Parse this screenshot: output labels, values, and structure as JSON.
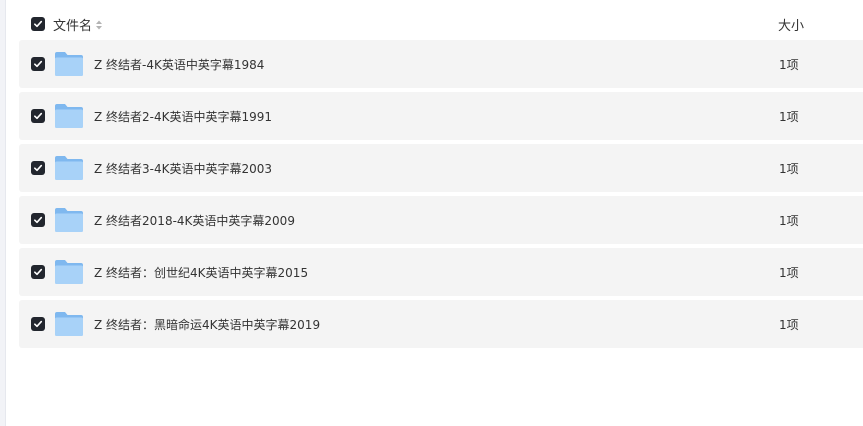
{
  "header": {
    "name_label": "文件名",
    "size_label": "大小",
    "select_all_checked": true
  },
  "files": [
    {
      "name": "Z 终结者-4K英语中英字幕1984",
      "size": "1项",
      "checked": true,
      "icon": "folder-icon"
    },
    {
      "name": "Z 终结者2-4K英语中英字幕1991",
      "size": "1项",
      "checked": true,
      "icon": "folder-icon"
    },
    {
      "name": "Z 终结者3-4K英语中英字幕2003",
      "size": "1项",
      "checked": true,
      "icon": "folder-icon"
    },
    {
      "name": "Z 终结者2018-4K英语中英字幕2009",
      "size": "1项",
      "checked": true,
      "icon": "folder-icon"
    },
    {
      "name": "Z 终结者：创世纪4K英语中英字幕2015",
      "size": "1项",
      "checked": true,
      "icon": "folder-icon"
    },
    {
      "name": "Z 终结者：黑暗命运4K英语中英字幕2019",
      "size": "1项",
      "checked": true,
      "icon": "folder-icon"
    }
  ],
  "colors": {
    "row_background": "#f4f4f4",
    "checkbox": "#22262e",
    "folder_back": "#7fb8ef",
    "folder_front": "#a8d2f8"
  }
}
